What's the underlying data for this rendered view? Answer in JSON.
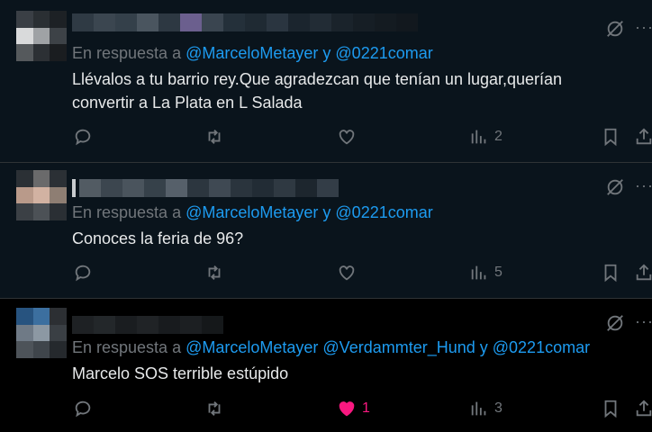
{
  "tweets": [
    {
      "reply_prefix": "En respuesta a",
      "mentions": "@MarceloMetayer y @0221comar",
      "text": "Llévalos a tu barrio rey.Que agradezcan que tenían un lugar,querían convertir a La Plata en L Salada",
      "views": "2",
      "likes": ""
    },
    {
      "reply_prefix": "En respuesta a",
      "mentions": "@MarceloMetayer y @0221comar",
      "text": "Conoces la feria de 96?",
      "views": "5",
      "likes": ""
    },
    {
      "reply_prefix": "En respuesta a",
      "mentions": "@MarceloMetayer @Verdammter_Hund y @0221comar",
      "text": "Marcelo SOS terrible estúpido",
      "views": "3",
      "likes": "1"
    }
  ],
  "more_label": "···",
  "colors": {
    "accent": "#1d9bf0",
    "like": "#f91880",
    "muted": "#71767b"
  },
  "icons": [
    "grok-icon",
    "more-icon",
    "reply-icon",
    "retweet-icon",
    "like-icon",
    "views-icon",
    "bookmark-icon",
    "share-icon"
  ]
}
